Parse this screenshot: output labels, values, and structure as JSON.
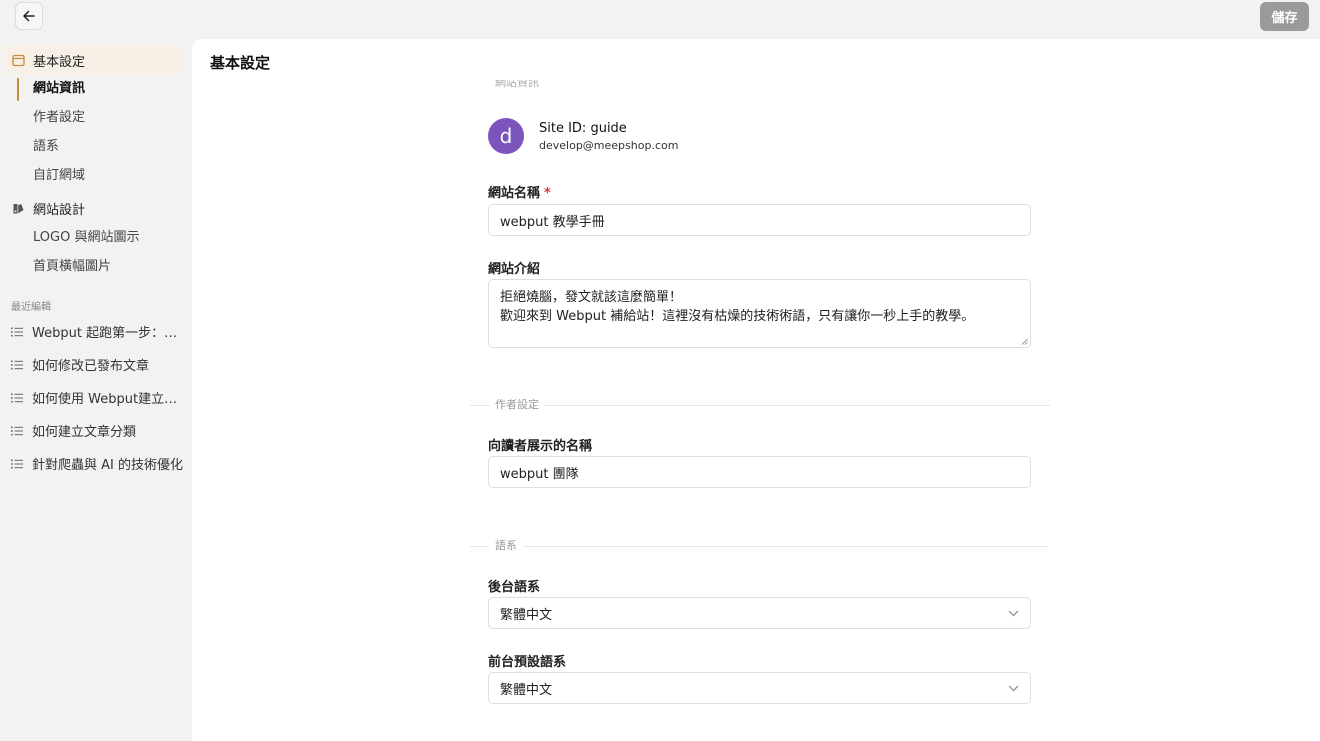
{
  "toolbar": {
    "save_label": "儲存"
  },
  "sidebar": {
    "groups": [
      {
        "label": "基本設定",
        "icon": "calendar-window-icon"
      },
      {
        "label": "網站設計",
        "icon": "palette-icon"
      }
    ],
    "basic_items": [
      "網站資訊",
      "作者設定",
      "語系",
      "自訂網域"
    ],
    "design_items": [
      "LOGO 與網站圖示",
      "首頁橫幅圖片"
    ],
    "recent_title": "最近編輯",
    "recent_items": [
      "Webput 起跑第一步：使用說明",
      "如何修改已發布文章",
      "如何使用 Webput建立文章",
      "如何建立文章分類",
      "針對爬蟲與 AI 的技術優化"
    ]
  },
  "main": {
    "title": "基本設定",
    "clipped_legend": "網站資訊",
    "avatar_letter": "d",
    "site_id": "Site ID: guide",
    "email": "develop@meepshop.com",
    "site_name_label": "網站名稱",
    "required_mark": "*",
    "site_name_value": "webput 教學手冊",
    "intro_label": "網站介紹",
    "intro_line1": "拒絕燒腦，發文就該這麼簡單！",
    "intro_line2": "歡迎來到 Webput 補給站！這裡沒有枯燥的技術術語，只有讓你一秒上手的教學。",
    "author_section": "作者設定",
    "author_label": "向讀者展示的名稱",
    "author_value": "webput 團隊",
    "lang_section": "語系",
    "backend_lang_label": "後台語系",
    "backend_lang_value": "繁體中文",
    "frontend_lang_label": "前台預設語系",
    "frontend_lang_value": "繁體中文"
  },
  "colors": {
    "accent": "#c98b3b",
    "active_bg": "#f7f0e6",
    "avatar": "#7b54bd",
    "save_button": "#9a9a9a"
  }
}
